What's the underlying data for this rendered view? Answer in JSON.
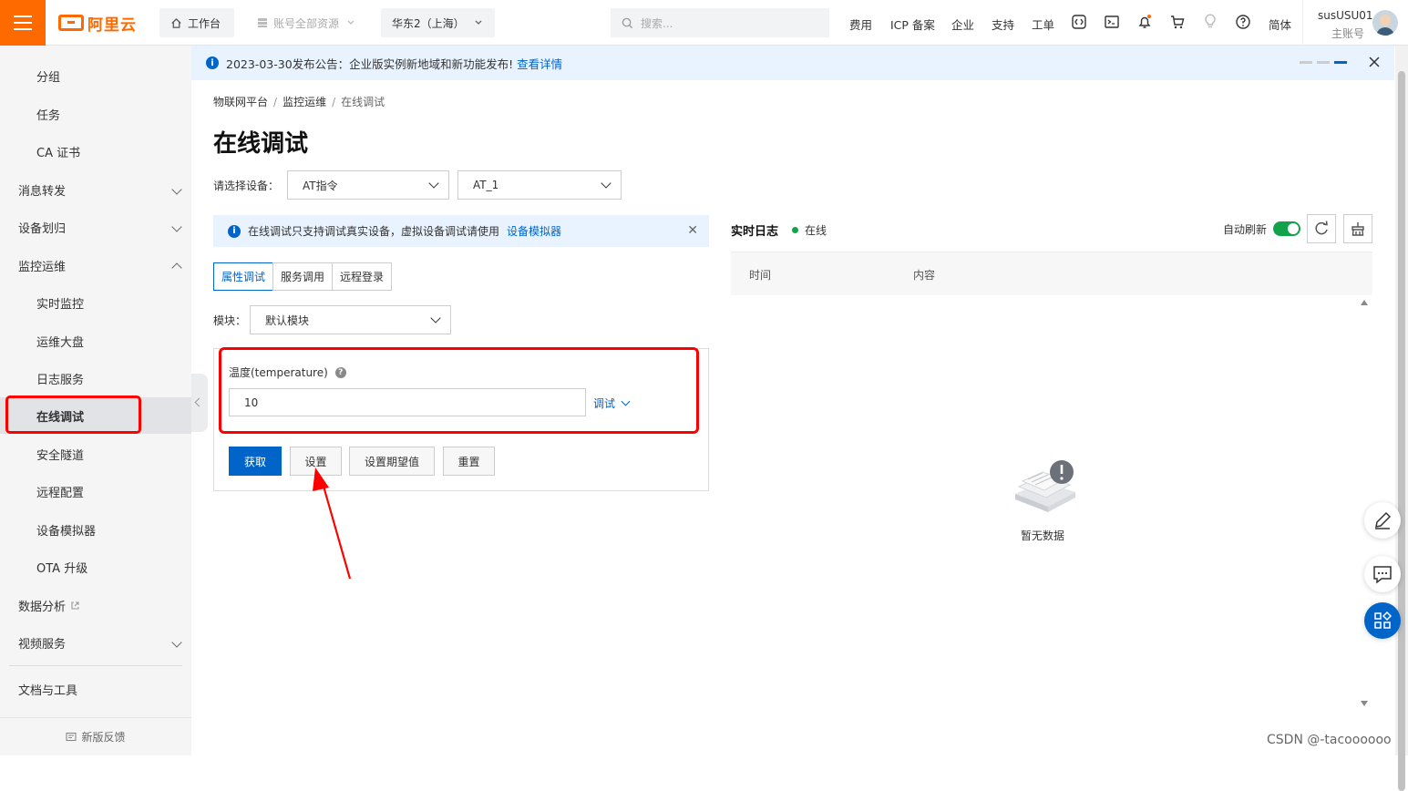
{
  "topbar": {
    "logo_text": "阿里云",
    "workbench": "工作台",
    "resource_scope": "账号全部资源",
    "region": "华东2（上海）",
    "search_placeholder": "搜索...",
    "nav": [
      "费用",
      "ICP 备案",
      "企业",
      "支持",
      "工单"
    ],
    "language": "简体",
    "username": "susUSU01",
    "account_type": "主账号"
  },
  "sidebar": {
    "items": [
      {
        "label": "分组",
        "level": "sub"
      },
      {
        "label": "任务",
        "level": "sub"
      },
      {
        "label": "CA 证书",
        "level": "sub"
      },
      {
        "label": "消息转发",
        "level": "top",
        "expand": "down"
      },
      {
        "label": "设备划归",
        "level": "top",
        "expand": "down"
      },
      {
        "label": "监控运维",
        "level": "top",
        "expand": "up"
      },
      {
        "label": "实时监控",
        "level": "sub"
      },
      {
        "label": "运维大盘",
        "level": "sub"
      },
      {
        "label": "日志服务",
        "level": "sub"
      },
      {
        "label": "在线调试",
        "level": "sub",
        "active": true
      },
      {
        "label": "安全隧道",
        "level": "sub"
      },
      {
        "label": "远程配置",
        "level": "sub"
      },
      {
        "label": "设备模拟器",
        "level": "sub"
      },
      {
        "label": "OTA 升级",
        "level": "sub"
      },
      {
        "label": "数据分析",
        "level": "top",
        "external": true
      },
      {
        "label": "视频服务",
        "level": "top",
        "expand": "down"
      }
    ],
    "docs": "文档与工具",
    "feedback": "新版反馈"
  },
  "announcement": {
    "text": "2023-03-30发布公告：企业版实例新地域和新功能发布!",
    "link": "查看详情"
  },
  "breadcrumb": [
    "物联网平台",
    "监控运维",
    "在线调试"
  ],
  "page_title": "在线调试",
  "device_select": {
    "label": "请选择设备：",
    "product": "AT指令",
    "device": "AT_1"
  },
  "tip": {
    "text": "在线调试只支持调试真实设备，虚拟设备调试请使用",
    "link": "设备模拟器"
  },
  "tabs": [
    "属性调试",
    "服务调用",
    "远程登录"
  ],
  "module": {
    "label": "模块：",
    "value": "默认模块"
  },
  "property": {
    "label": "温度(temperature)",
    "value": "10",
    "action": "调试"
  },
  "buttons": [
    "获取",
    "设置",
    "设置期望值",
    "重置"
  ],
  "log": {
    "title": "实时日志",
    "status": "在线",
    "auto_refresh": "自动刷新",
    "col_time": "时间",
    "col_content": "内容",
    "empty": "暂无数据"
  },
  "watermark": "CSDN @-tacoooooo",
  "colors": {
    "brand": "#ff6a00",
    "primary": "#0064c8",
    "online": "#12a34a",
    "annotation": "#ff0000"
  }
}
